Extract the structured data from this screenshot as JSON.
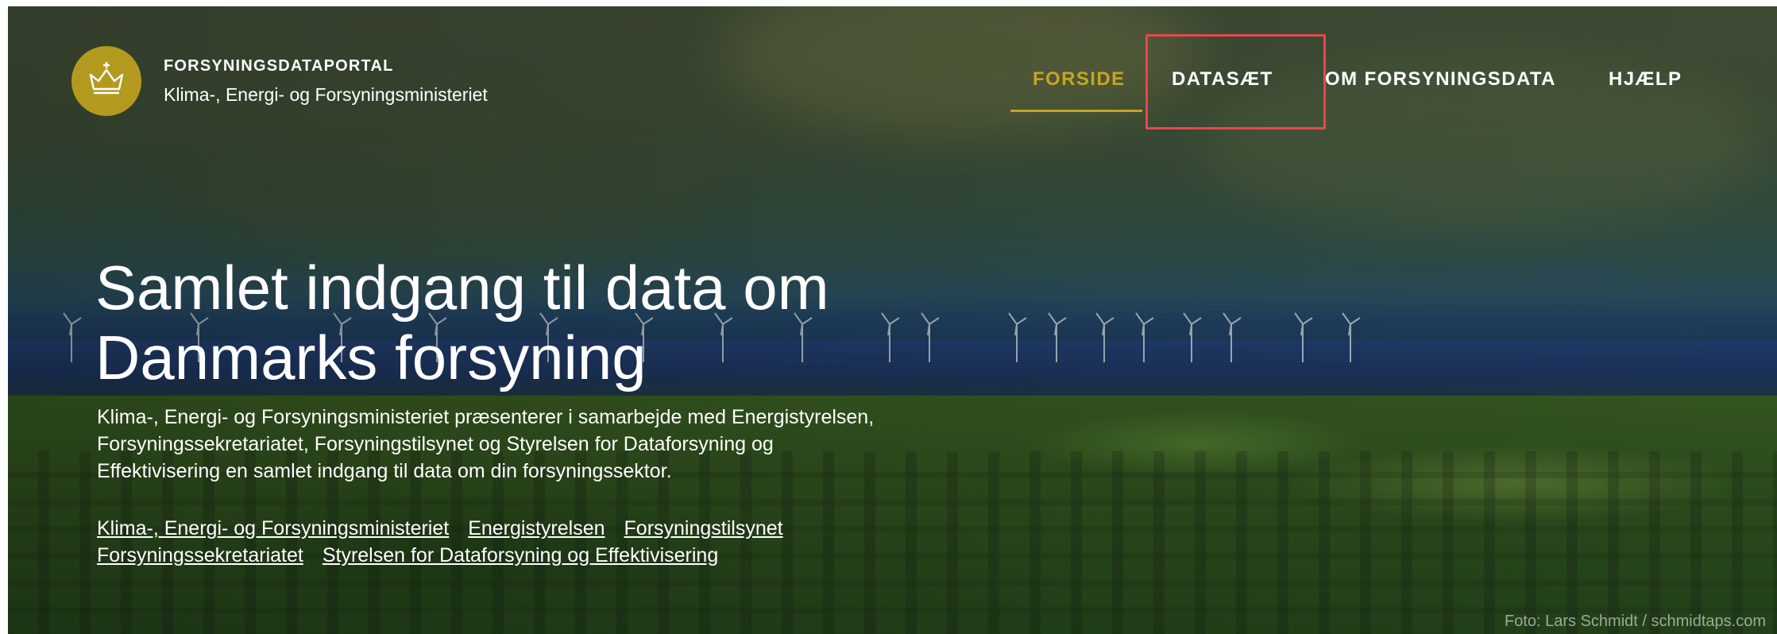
{
  "brand": {
    "title": "FORSYNINGSDATAPORTAL",
    "subtitle": "Klima-, Energi- og Forsyningsministeriet",
    "logo_icon": "crown-icon",
    "logo_color": "#b39a1f"
  },
  "nav": {
    "items": [
      {
        "label": "FORSIDE",
        "active": true
      },
      {
        "label": "DATASÆT",
        "active": false,
        "highlighted": true
      },
      {
        "label": "OM FORSYNINGSDATA",
        "active": false
      },
      {
        "label": "HJÆLP",
        "active": false
      }
    ],
    "active_color": "#c8a51f",
    "highlight_color": "#e8474d"
  },
  "hero": {
    "title_line1": "Samlet indgang til data om",
    "title_line2": "Danmarks forsyning",
    "description": "Klima-, Energi- og Forsyningsministeriet præsenterer i samarbejde med Energistyrelsen, Forsyningssekretariatet, Forsyningstilsynet og Styrelsen for Dataforsyning og Effektivisering en samlet indgang til data om din forsyningssektor.",
    "links": [
      "Klima-, Energi- og Forsyningsministeriet",
      "Energistyrelsen",
      "Forsyningstilsynet",
      "Forsyningssekretariatet",
      "Styrelsen for Dataforsyning og Effektivisering"
    ]
  },
  "photo_credit": "Foto: Lars Schmidt / schmidtaps.com"
}
